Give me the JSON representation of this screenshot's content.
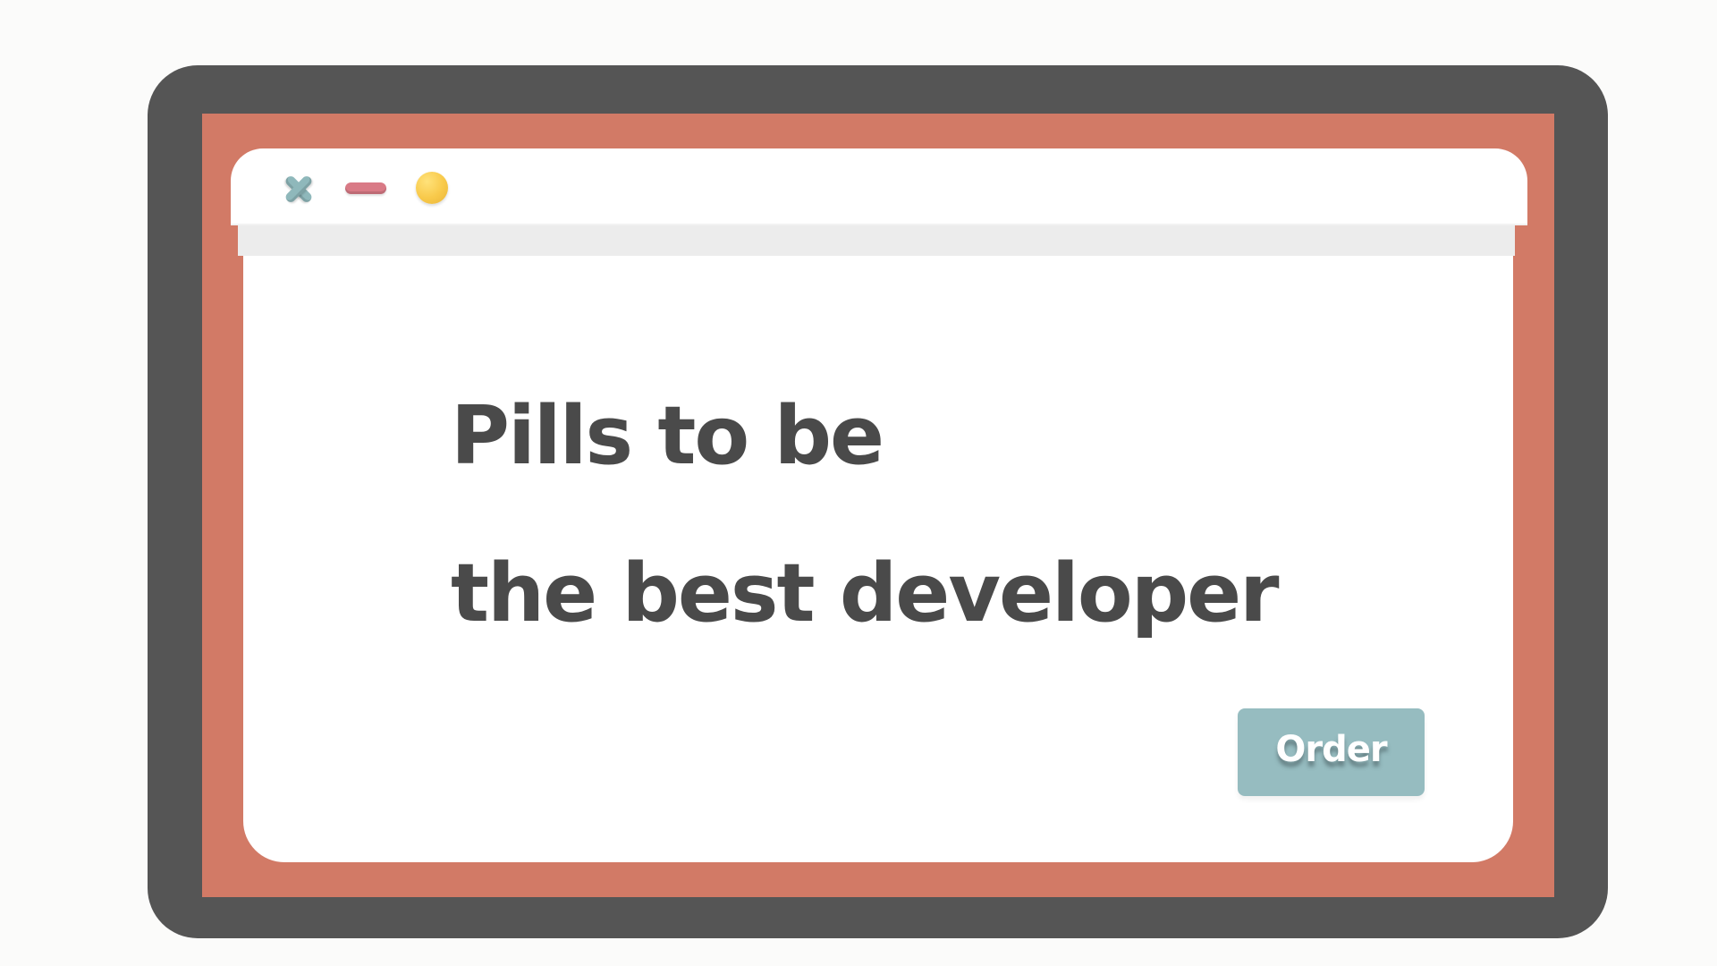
{
  "window": {
    "controls": {
      "close_icon": "close-icon",
      "minimize_icon": "minimize-icon",
      "maximize_icon": "maximize-icon"
    },
    "colors": {
      "device_frame": "#555555",
      "device_border": "#d27a66",
      "window": "#ffffff",
      "close": "#8fb8bb",
      "minimize": "#d97a86",
      "maximize": "#f8c94a",
      "button": "#96bcc0",
      "text": "#4a4a4a"
    }
  },
  "main": {
    "headline_line1": "Pills to be",
    "headline_line2": "the best developer",
    "order_label": "Order"
  }
}
